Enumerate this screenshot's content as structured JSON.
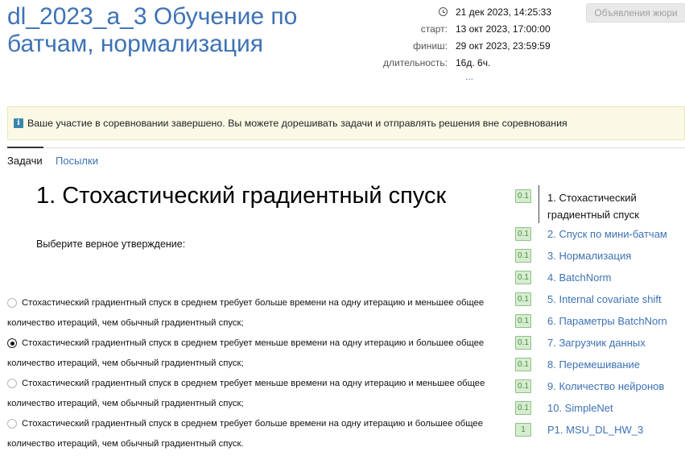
{
  "contest": {
    "title": "dl_2023_a_3 Обучение по батчам, нормализация"
  },
  "meta": {
    "current_time": "21 дек 2023, 14:25:33",
    "start_label": "старт:",
    "start_value": "13 окт 2023, 17:00:00",
    "finish_label": "финиш:",
    "finish_value": "29 окт 2023, 23:59:59",
    "duration_label": "длительность:",
    "duration_value": "16д. 6ч.",
    "more": "..."
  },
  "jury_button": "Объявления жюри",
  "alert": {
    "icon": "i",
    "text": "Ваше участие в соревновании завершено. Вы можете дорешивать задачи и отправлять решения вне соревнования"
  },
  "tabs": [
    {
      "label": "Задачи"
    },
    {
      "label": "Посылки"
    }
  ],
  "problem": {
    "title": "1. Стохастический градиентный спуск",
    "question": "Выберите верное утверждение:",
    "options": [
      {
        "line1": "Стохастический градиентный спуск в среднем требует больше времени на одну итерацию и меньшее общее",
        "line2": "количество итераций, чем обычный градиентный спуск;",
        "checked": false
      },
      {
        "line1": "Стохастический градиентный спуск в среднем требует меньше времени на одну итерацию и большее общее",
        "line2": "количество итераций, чем обычный градиентный спуск;",
        "checked": true
      },
      {
        "line1": "Стохастический градиентный спуск в среднем требует меньше времени на одну итерацию и меньшее общее",
        "line2": "количество итераций, чем обычный градиентный спуск;",
        "checked": false
      },
      {
        "line1": "Стохастический градиентный спуск в среднем требует больше времени на одну итерацию и большее общее",
        "line2": "количество итераций, чем обычный градиентный спуск.",
        "checked": false
      }
    ]
  },
  "sidebar": {
    "items": [
      {
        "score": "0.1",
        "label": "1. Стохастический градиентный спуск"
      },
      {
        "score": "0.1",
        "label": "2. Спуск по мини-батчам"
      },
      {
        "score": "0.1",
        "label": "3. Нормализация"
      },
      {
        "score": "0.1",
        "label": "4. BatchNorm"
      },
      {
        "score": "0.1",
        "label": "5. Internal covariate shift"
      },
      {
        "score": "0.1",
        "label": "6. Параметры BatchNorn"
      },
      {
        "score": "0.1",
        "label": "7. Загрузчик данных"
      },
      {
        "score": "0.1",
        "label": "8. Перемешивание"
      },
      {
        "score": "0.1",
        "label": "9. Количество нейронов"
      },
      {
        "score": "0.1",
        "label": "10. SimpleNet"
      },
      {
        "score": "1",
        "label": "P1. MSU_DL_HW_3"
      }
    ]
  },
  "colors": {
    "link": "#3d72b4",
    "badge_bg": "#d6ecd0",
    "badge_border": "#8fc086",
    "alert_bg": "#fbf9e6"
  }
}
